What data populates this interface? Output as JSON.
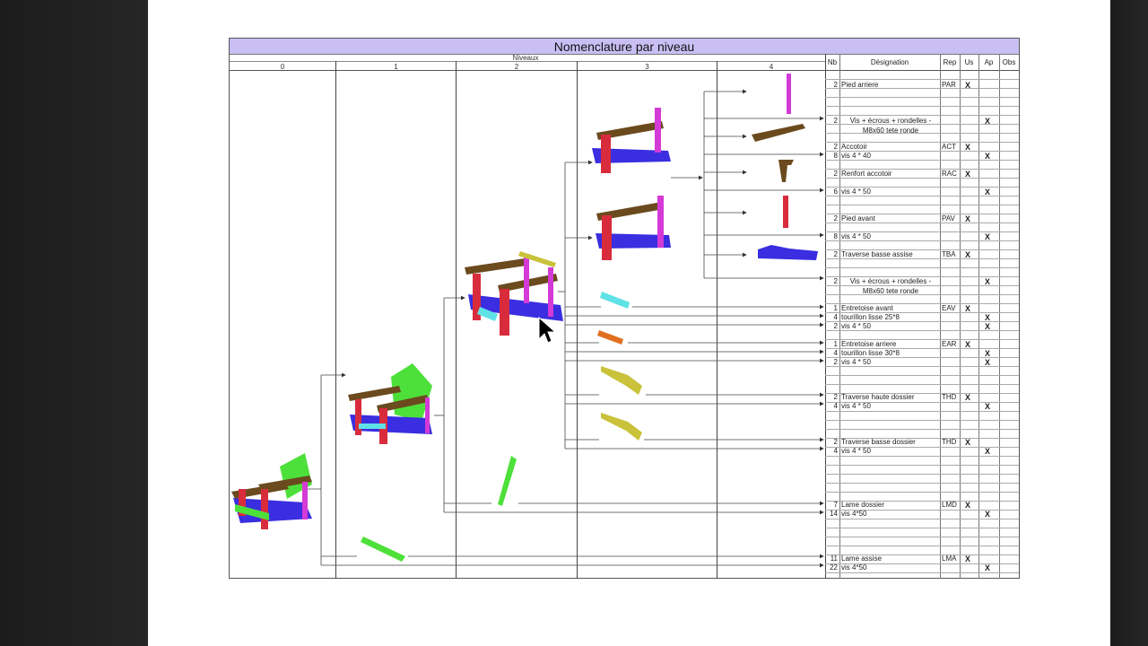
{
  "title": "Nomenclature par niveau",
  "levels_label": "Niveaux",
  "levels": [
    "0",
    "1",
    "2",
    "3",
    "4"
  ],
  "table_headers": {
    "nb": "Nb",
    "designation": "Désignation",
    "rep": "Rep",
    "us": "Us",
    "ap": "Ap",
    "obs": "Obs"
  },
  "rows": [
    {
      "nb": "2",
      "designation": "Pied arriere",
      "rep": "PAR",
      "us": "X",
      "ap": ""
    },
    {
      "nb": "2",
      "designation": "Vis + écrous + rondelles - M8x60 tete ronde",
      "rep": "",
      "us": "",
      "ap": "X"
    },
    {
      "nb": "2",
      "designation": "Accotoir",
      "rep": "ACT",
      "us": "X",
      "ap": ""
    },
    {
      "nb": "8",
      "designation": "vis 4 * 40",
      "rep": "",
      "us": "",
      "ap": "X"
    },
    {
      "nb": "2",
      "designation": "Renfort accotoir",
      "rep": "RAC",
      "us": "X",
      "ap": ""
    },
    {
      "nb": "6",
      "designation": "vis 4 * 50",
      "rep": "",
      "us": "",
      "ap": "X"
    },
    {
      "nb": "2",
      "designation": "Pied avant",
      "rep": "PAV",
      "us": "X",
      "ap": ""
    },
    {
      "nb": "8",
      "designation": "vis 4 * 50",
      "rep": "",
      "us": "",
      "ap": "X"
    },
    {
      "nb": "2",
      "designation": "Traverse basse assise",
      "rep": "TBA",
      "us": "X",
      "ap": ""
    },
    {
      "nb": "2",
      "designation": "Vis + écrous + rondelles - M8x60 tete ronde",
      "rep": "",
      "us": "",
      "ap": "X"
    },
    {
      "nb": "1",
      "designation": "Entretoise avant",
      "rep": "EAV",
      "us": "X",
      "ap": ""
    },
    {
      "nb": "4",
      "designation": "tourillon lisse 25*8",
      "rep": "",
      "us": "",
      "ap": "X"
    },
    {
      "nb": "2",
      "designation": "vis 4 * 50",
      "rep": "",
      "us": "",
      "ap": "X"
    },
    {
      "nb": "1",
      "designation": "Entretoise arriere",
      "rep": "EAR",
      "us": "X",
      "ap": ""
    },
    {
      "nb": "4",
      "designation": "tourillon lisse 30*8",
      "rep": "",
      "us": "",
      "ap": "X"
    },
    {
      "nb": "2",
      "designation": "vis 4 * 50",
      "rep": "",
      "us": "",
      "ap": "X"
    },
    {
      "nb": "2",
      "designation": "Traverse haute dossier",
      "rep": "THD",
      "us": "X",
      "ap": ""
    },
    {
      "nb": "4",
      "designation": "vis 4 * 50",
      "rep": "",
      "us": "",
      "ap": "X"
    },
    {
      "nb": "2",
      "designation": "Traverse basse dossier",
      "rep": "THD",
      "us": "X",
      "ap": ""
    },
    {
      "nb": "4",
      "designation": "vis 4 * 50",
      "rep": "",
      "us": "",
      "ap": "X"
    },
    {
      "nb": "7",
      "designation": "Lame dossier",
      "rep": "LMD",
      "us": "X",
      "ap": ""
    },
    {
      "nb": "14",
      "designation": "vis 4*50",
      "rep": "",
      "us": "",
      "ap": "X"
    },
    {
      "nb": "11",
      "designation": "Lame assise",
      "rep": "LMA",
      "us": "X",
      "ap": ""
    },
    {
      "nb": "22",
      "designation": "vis 4*50",
      "rep": "",
      "us": "",
      "ap": "X"
    }
  ],
  "colors": {
    "title_bar": "#c9bff4",
    "red": "#d82c3c",
    "blue": "#3a2ee0",
    "brown": "#6b4a1e",
    "magenta": "#d43ad6",
    "green": "#4ee03a",
    "cyan": "#5fe2e6",
    "yellow": "#c9c23a",
    "orange": "#e07020"
  }
}
